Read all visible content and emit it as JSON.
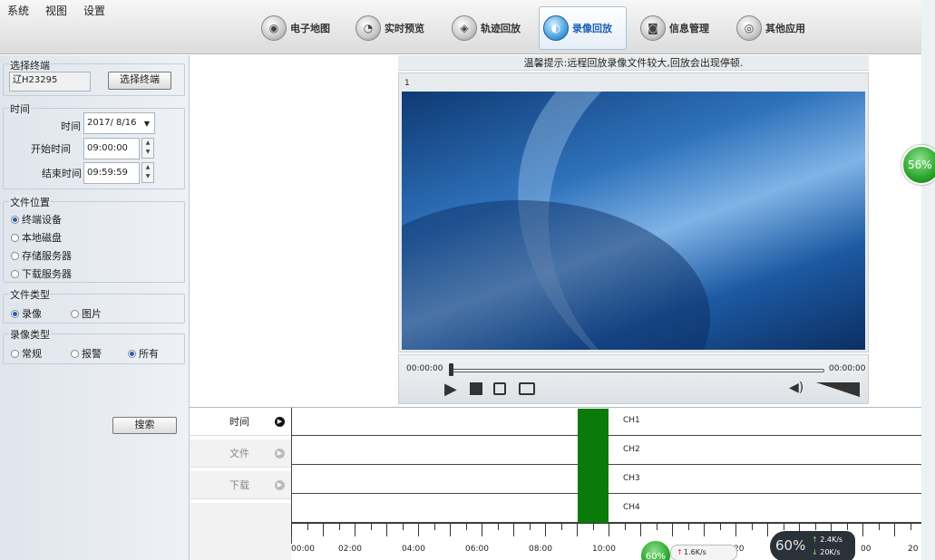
{
  "menu": {
    "system": "系统",
    "view": "视图",
    "settings": "设置"
  },
  "tabs": [
    {
      "label": "电子地图",
      "icon": "map-globe-icon"
    },
    {
      "label": "实时预览",
      "icon": "camera-preview-icon"
    },
    {
      "label": "轨迹回放",
      "icon": "track-playback-icon"
    },
    {
      "label": "录像回放",
      "icon": "video-playback-icon",
      "active": true
    },
    {
      "label": "信息管理",
      "icon": "info-manage-icon"
    },
    {
      "label": "其他应用",
      "icon": "other-apps-icon"
    }
  ],
  "left": {
    "terminal": {
      "group": "选择终端",
      "value": "辽H23295",
      "button": "选择终端"
    },
    "time": {
      "group": "时间",
      "date_label": "时间",
      "date": "2017/ 8/16",
      "start_label": "开始时间",
      "start": "09:00:00",
      "end_label": "结束时间",
      "end": "09:59:59"
    },
    "location": {
      "group": "文件位置",
      "options": [
        "终端设备",
        "本地磁盘",
        "存储服务器",
        "下载服务器"
      ],
      "selected": 0
    },
    "filetype": {
      "group": "文件类型",
      "options": [
        "录像",
        "图片"
      ],
      "selected": 0
    },
    "rectype": {
      "group": "录像类型",
      "options": [
        "常规",
        "报警",
        "所有"
      ],
      "selected": 2
    },
    "search": "搜索"
  },
  "notice": "温馨提示:远程回放录像文件较大,回放会出现停顿.",
  "player": {
    "channel": "1",
    "time_start": "00:00:00",
    "time_end": "00:00:00"
  },
  "bottom_tabs": [
    {
      "label": "时间",
      "active": true
    },
    {
      "label": "文件",
      "active": false
    },
    {
      "label": "下载",
      "active": false
    }
  ],
  "channels": [
    "CH1",
    "CH2",
    "CH3",
    "CH4"
  ],
  "time_axis": [
    "00:00",
    "02:00",
    "04:00",
    "06:00",
    "08:00",
    "10:00",
    "20",
    "00",
    "20"
  ],
  "widgets": {
    "side_percent": "56%",
    "bottom_percent1": "60%",
    "bottom_speed1": "1.6K/s",
    "bottom_percent2": "60%",
    "up": "2.4K/s",
    "down": "20K/s"
  },
  "colors": {
    "record": "#0a7a0a",
    "accent": "#1a5fb4"
  }
}
